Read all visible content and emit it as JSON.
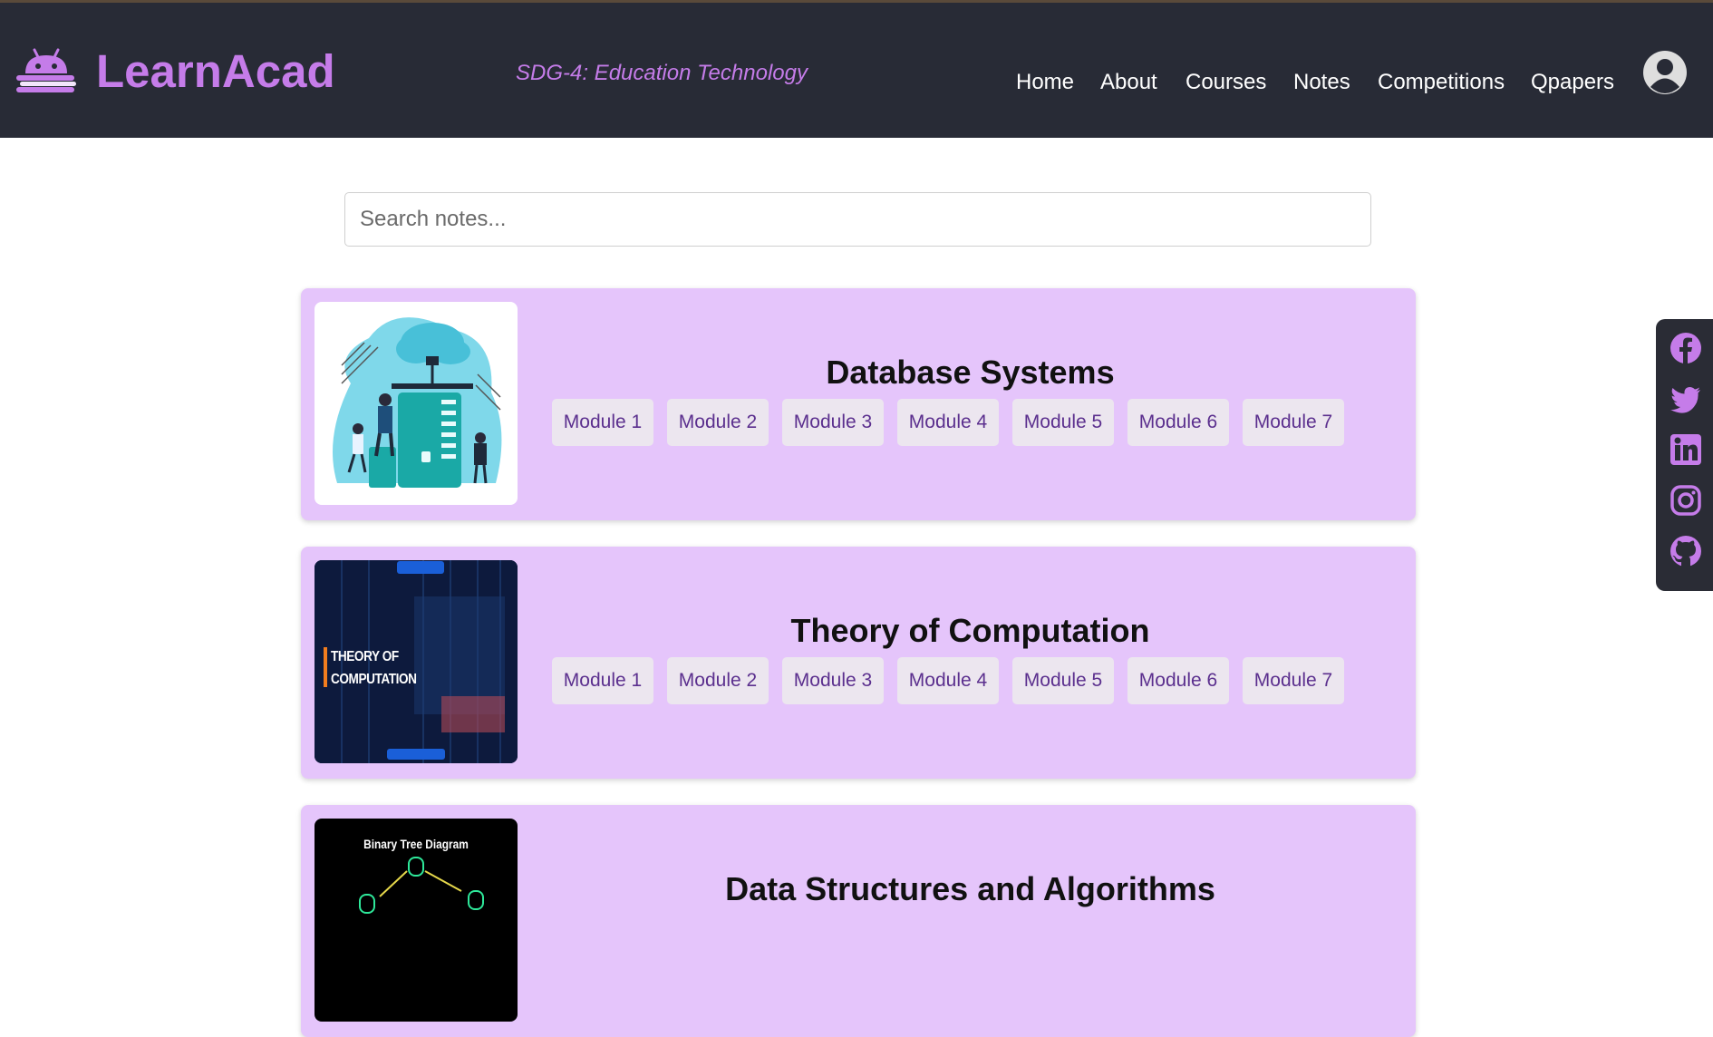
{
  "header": {
    "brand": "LearnAcad",
    "tagline": "SDG-4: Education Technology",
    "nav": [
      "Home",
      "About",
      "Courses",
      "Notes",
      "Competitions",
      "Qpapers"
    ]
  },
  "search": {
    "placeholder": "Search notes..."
  },
  "courses": [
    {
      "title": "Database Systems",
      "modules": [
        "Module 1",
        "Module 2",
        "Module 3",
        "Module 4",
        "Module 5",
        "Module 6",
        "Module 7"
      ]
    },
    {
      "title": "Theory of Computation",
      "image_text": [
        "THEORY OF",
        "COMPUTATION"
      ],
      "modules": [
        "Module 1",
        "Module 2",
        "Module 3",
        "Module 4",
        "Module 5",
        "Module 6",
        "Module 7"
      ]
    },
    {
      "title": "Data Structures and Algorithms",
      "image_text": [
        "Binary Tree Diagram"
      ],
      "modules": []
    }
  ],
  "social": [
    "facebook-icon",
    "twitter-icon",
    "linkedin-icon",
    "instagram-icon",
    "github-icon"
  ],
  "colors": {
    "accent": "#c57ce9",
    "header_bg": "#282b36",
    "card_bg": "#e5c5fb",
    "module_text": "#5b2f8e"
  }
}
